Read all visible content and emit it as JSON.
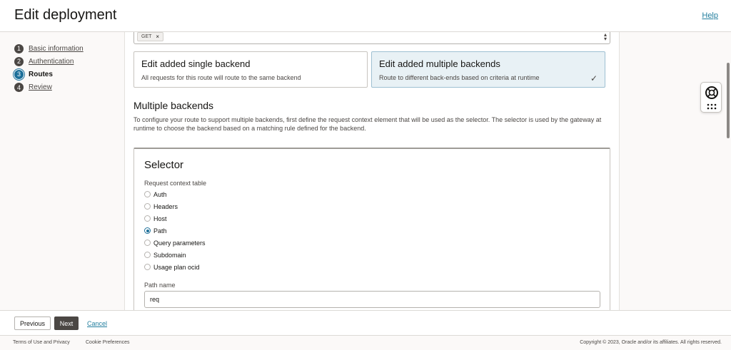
{
  "header": {
    "title": "Edit deployment",
    "help": "Help"
  },
  "steps": [
    {
      "num": "1",
      "label": "Basic information"
    },
    {
      "num": "2",
      "label": "Authentication"
    },
    {
      "num": "3",
      "label": "Routes"
    },
    {
      "num": "4",
      "label": "Review"
    }
  ],
  "methods": {
    "chip": "GET",
    "remove": "×"
  },
  "cards": {
    "single": {
      "title": "Edit added single backend",
      "desc": "All requests for this route will route to the same backend"
    },
    "multiple": {
      "title": "Edit added multiple backends",
      "desc": "Route to different back-ends based on criteria at runtime",
      "check": "✓"
    }
  },
  "section": {
    "title": "Multiple backends",
    "desc": "To configure your route to support multiple backends, first define the request context element that will be used as the selector. The selector is used by the gateway at runtime to choose the backend based on a matching rule defined for the backend."
  },
  "selector": {
    "title": "Selector",
    "table_label": "Request context table",
    "options": [
      "Auth",
      "Headers",
      "Host",
      "Path",
      "Query parameters",
      "Subdomain",
      "Usage plan ocid"
    ],
    "selected": "Path",
    "path_label": "Path name",
    "path_value": "req"
  },
  "footer": {
    "previous": "Previous",
    "next": "Next",
    "cancel": "Cancel"
  },
  "legal": {
    "terms": "Terms of Use and Privacy",
    "cookies": "Cookie Preferences",
    "copyright": "Copyright © 2023, Oracle and/or its affiliates. All rights reserved."
  }
}
